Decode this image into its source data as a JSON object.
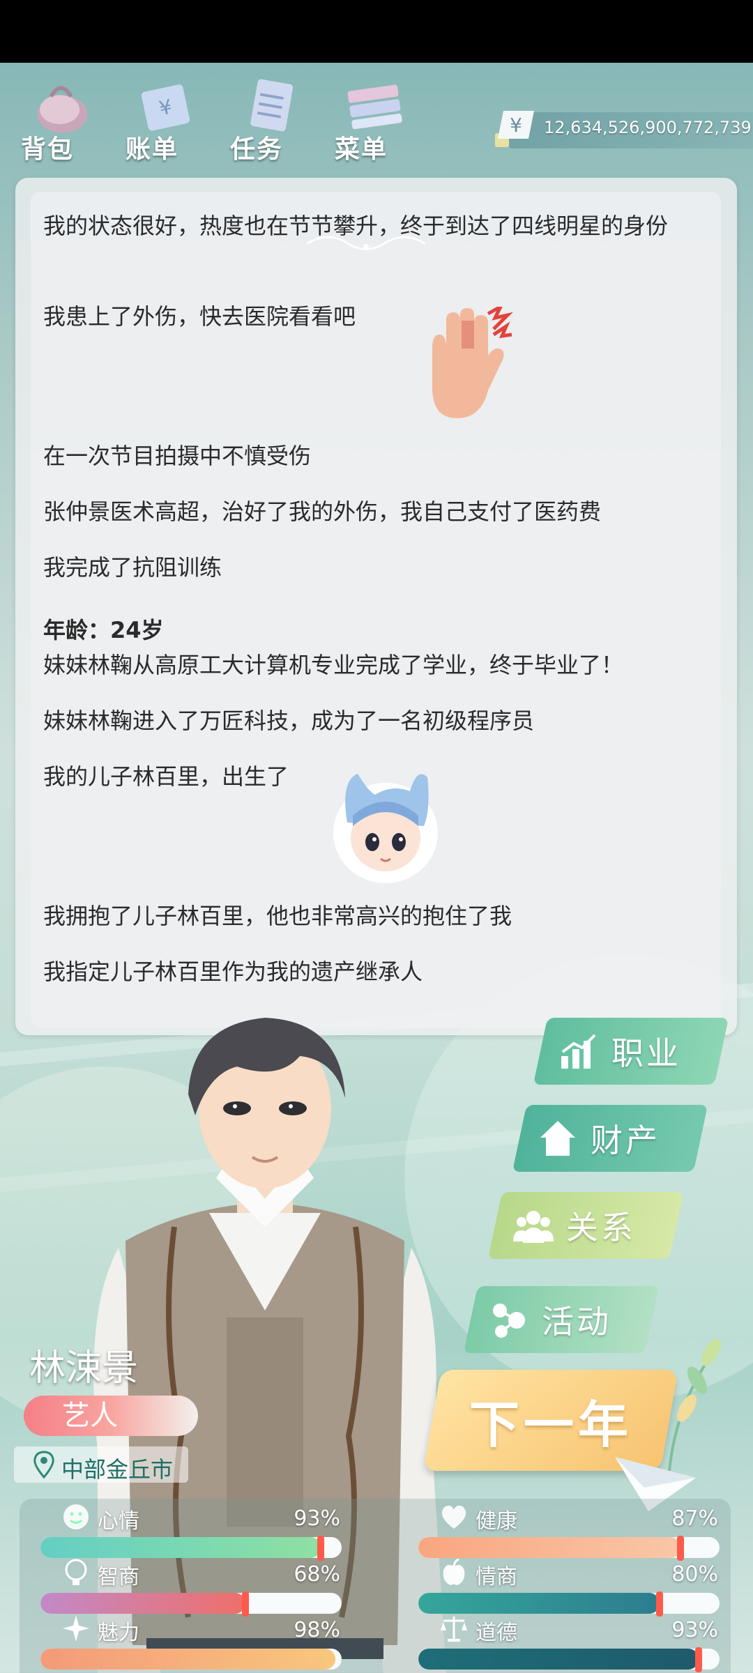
{
  "nav": {
    "items": [
      {
        "label": "背包",
        "icon": "bag-icon"
      },
      {
        "label": "账单",
        "icon": "bill-icon"
      },
      {
        "label": "任务",
        "icon": "task-icon"
      },
      {
        "label": "菜单",
        "icon": "menu-icon"
      }
    ]
  },
  "money": {
    "value": "12,634,526,900,772,739",
    "icon": "yen-icon"
  },
  "log": {
    "line1": "我的状态很好，热度也在节节攀升，终于到达了四线明星的身份",
    "line2": "我患上了外伤，快去医院看看吧",
    "line3": "在一次节目拍摄中不慎受伤",
    "line4": "张仲景医术高超，治好了我的外伤，我自己支付了医药费",
    "line5": "我完成了抗阻训练",
    "age": "年龄：24岁",
    "line6": "妹妹林鞠从高原工大计算机专业完成了学业，终于毕业了！",
    "line7": "妹妹林鞠进入了万匠科技，成为了一名初级程序员",
    "line8": "我的儿子林百里，出生了",
    "line9": "我拥抱了儿子林百里，他也非常高兴的抱住了我",
    "line10": "我指定儿子林百里作为我的遗产继承人"
  },
  "side_menu": {
    "career": "职业",
    "assets": "财产",
    "relations": "关系",
    "activity": "活动",
    "next_year": "下一年"
  },
  "character": {
    "name": "林涑景",
    "job": "艺人",
    "location": "中部金丘市"
  },
  "stats": [
    {
      "label": "心情",
      "value": "93%",
      "level": 0.93,
      "icon": "smile-icon",
      "color_from": "#63cfc4",
      "color_to": "#8fe0a2"
    },
    {
      "label": "健康",
      "value": "87%",
      "level": 0.87,
      "icon": "heart-icon",
      "color_from": "#f9a67f",
      "color_to": "#f9c7a7"
    },
    {
      "label": "智商",
      "value": "68%",
      "level": 0.68,
      "icon": "brain-icon",
      "color_from": "#c289c8",
      "color_to": "#ef6f6a"
    },
    {
      "label": "情商",
      "value": "80%",
      "level": 0.8,
      "icon": "apple-icon",
      "color_from": "#35a69a",
      "color_to": "#2c7d8f"
    },
    {
      "label": "魅力",
      "value": "98%",
      "level": 0.98,
      "icon": "sparkle-icon",
      "color_from": "#f49a7a",
      "color_to": "#f8c77d"
    },
    {
      "label": "道德",
      "value": "93%",
      "level": 0.93,
      "icon": "scale-icon",
      "color_from": "#1e6e78",
      "color_to": "#1e5a6c"
    }
  ]
}
